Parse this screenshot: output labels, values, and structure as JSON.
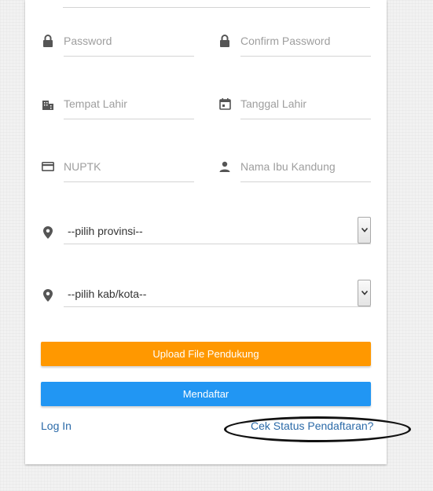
{
  "form": {
    "password_placeholder": "Password",
    "confirm_password_placeholder": "Confirm Password",
    "tempat_lahir_placeholder": "Tempat Lahir",
    "tanggal_lahir_placeholder": "Tanggal Lahir",
    "nuptk_placeholder": "NUPTK",
    "nama_ibu_placeholder": "Nama Ibu Kandung",
    "provinsi_selected": "--pilih provinsi--",
    "kabkota_selected": "--pilih kab/kota--"
  },
  "buttons": {
    "upload_label": "Upload File Pendukung",
    "daftar_label": "Mendaftar"
  },
  "links": {
    "login_label": "Log In",
    "cek_status_label": "Cek Status Pendaftaran?"
  },
  "icons": {
    "password": "lock-icon",
    "confirm_password": "lock-icon",
    "tempat_lahir": "city-icon",
    "tanggal_lahir": "calendar-icon",
    "nuptk": "credit-card-icon",
    "nama_ibu": "person-icon",
    "provinsi": "location-pin-icon",
    "kabkota": "location-pin-icon"
  },
  "colors": {
    "upload_button": "#ff9800",
    "daftar_button": "#2196f3",
    "link": "#2b6aa8",
    "icon": "#555555"
  }
}
